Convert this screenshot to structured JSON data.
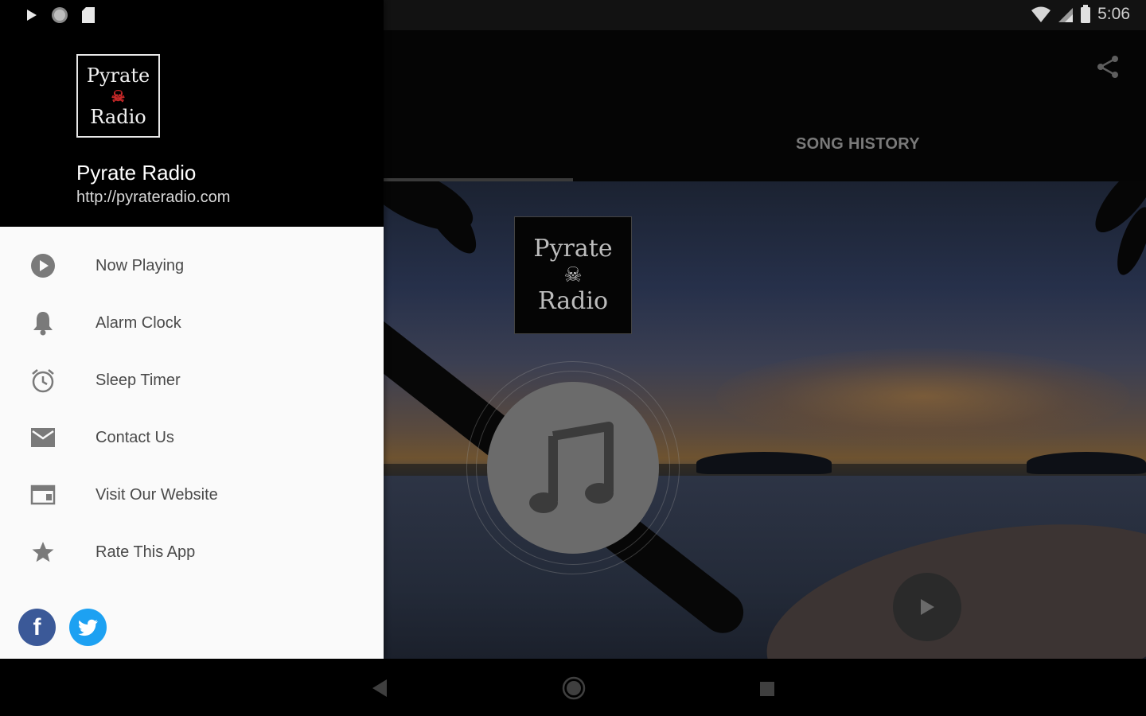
{
  "status": {
    "time": "5:06"
  },
  "drawer": {
    "logo": {
      "line1": "Pyrate",
      "line2": "Radio"
    },
    "station_name": "Pyrate Radio",
    "station_url": "http://pyrateradio.com",
    "menu": [
      {
        "label": "Now Playing",
        "icon": "play-circle-icon"
      },
      {
        "label": "Alarm Clock",
        "icon": "bell-icon"
      },
      {
        "label": "Sleep Timer",
        "icon": "alarm-clock-icon"
      },
      {
        "label": "Contact Us",
        "icon": "envelope-icon"
      },
      {
        "label": "Visit Our Website",
        "icon": "browser-window-icon"
      },
      {
        "label": "Rate This App",
        "icon": "star-icon"
      }
    ],
    "social": {
      "facebook_glyph": "f"
    }
  },
  "main": {
    "tab_song_history": "SONG HISTORY",
    "artwork_logo": {
      "line1": "Pyrate",
      "line2": "Radio"
    }
  },
  "colors": {
    "drawer_bg": "#fafafa",
    "header_bg": "#000000",
    "menu_text": "#4a4a4a",
    "facebook": "#3b5998",
    "twitter": "#1da1f2"
  }
}
